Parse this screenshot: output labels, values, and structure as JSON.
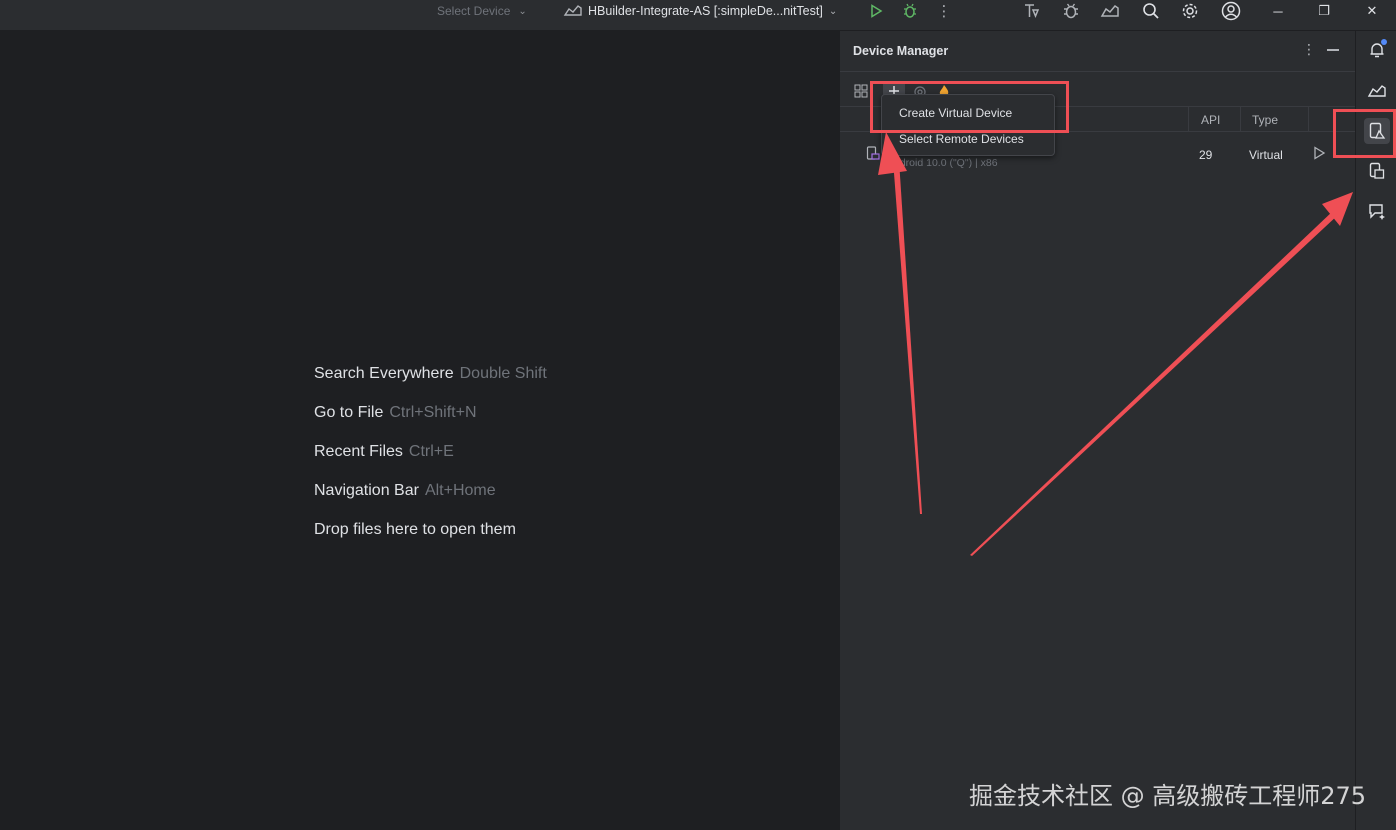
{
  "toolbar": {
    "select_device": "Select Device",
    "run_config": "HBuilder-Integrate-AS [:simpleDe...nitTest]"
  },
  "editor": {
    "hints": [
      {
        "label": "Search Everywhere",
        "shortcut": "Double Shift"
      },
      {
        "label": "Go to File",
        "shortcut": "Ctrl+Shift+N"
      },
      {
        "label": "Recent Files",
        "shortcut": "Ctrl+E"
      },
      {
        "label": "Navigation Bar",
        "shortcut": "Alt+Home"
      },
      {
        "label": "Drop files here to open them",
        "shortcut": ""
      }
    ]
  },
  "device_manager": {
    "title": "Device Manager",
    "columns": {
      "api": "API",
      "type": "Type"
    },
    "device": {
      "subtitle": "Android 10.0 (\"Q\") | x86",
      "api": "29",
      "type": "Virtual"
    },
    "menu": {
      "create_virtual_device": "Create Virtual Device",
      "select_remote_devices": "Select Remote Devices"
    }
  },
  "watermark": "掘金技术社区 @ 高级搬砖工程师275",
  "colors": {
    "accent": "#548af7",
    "run_green": "#5fb865",
    "annotation_red": "#ef4f55",
    "editor_bg": "#1e1f22",
    "panel_bg": "#2b2d30"
  },
  "icons": [
    "chevron-down-icon",
    "android-project-icon",
    "run-icon",
    "debug-icon",
    "more-vert-icon",
    "build-icon",
    "bug-icon",
    "sync-icon",
    "search-icon",
    "settings-icon",
    "account-icon",
    "minimize-icon",
    "restore-icon",
    "close-icon",
    "grid-icon",
    "plus-icon",
    "wifi-icon",
    "fire-icon",
    "device-icon",
    "play-icon",
    "notifications-icon",
    "gradle-icon",
    "device-manager-icon",
    "device-mirror-icon",
    "ai-chat-icon"
  ]
}
